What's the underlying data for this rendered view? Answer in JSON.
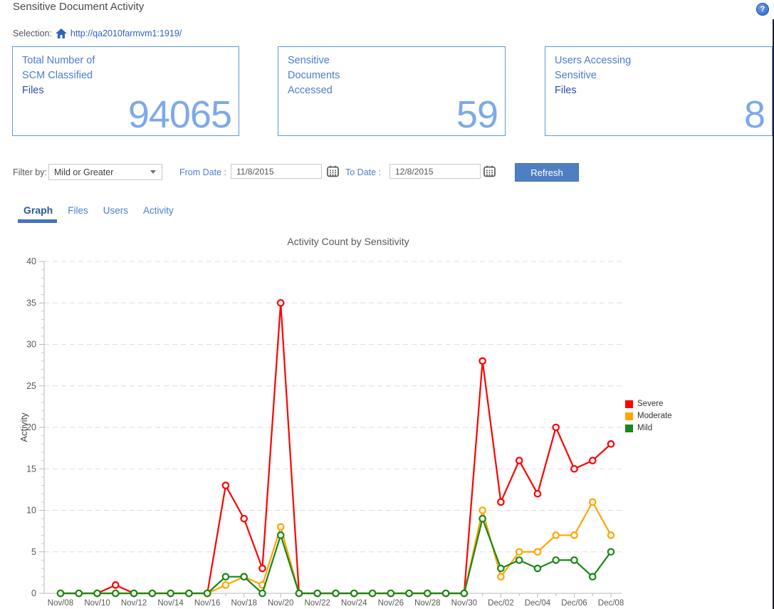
{
  "header": {
    "title": "Sensitive Document Activity",
    "help_glyph": "?"
  },
  "selection": {
    "label": "Selection:",
    "url": "http://qa2010farmvm1:1919/"
  },
  "cards": [
    {
      "lines": [
        "Total Number of",
        "SCM Classified",
        "Files"
      ],
      "dark_lines": [
        2
      ],
      "value": "94065"
    },
    {
      "lines": [
        "Sensitive",
        "Documents",
        "Accessed"
      ],
      "dark_lines": [],
      "value": "59"
    },
    {
      "lines": [
        "Users Accessing",
        "Sensitive",
        "Files"
      ],
      "dark_lines": [
        2
      ],
      "value": "8"
    }
  ],
  "filters": {
    "filter_by_label": "Filter by:",
    "filter_value": "Mild or Greater",
    "from_label": "From Date :",
    "from_value": "11/8/2015",
    "to_label": "To Date :",
    "to_value": "12/8/2015",
    "refresh_label": "Refresh"
  },
  "tabs": [
    {
      "label": "Graph",
      "active": true
    },
    {
      "label": "Files",
      "active": false
    },
    {
      "label": "Users",
      "active": false
    },
    {
      "label": "Activity",
      "active": false
    }
  ],
  "colors": {
    "accent_blue": "#4472c4",
    "card_border": "#5b9bd5",
    "link_blue": "#2e64bd",
    "refresh_button": "#4e80c1"
  },
  "chart_data": {
    "type": "line",
    "title": "Activity Count by Sensitivity",
    "xlabel": "",
    "ylabel": "Activity",
    "ylim": [
      0,
      40
    ],
    "ytick_step": 5,
    "x_labels_every": 2,
    "grid": "dashed-horizontal",
    "legend_position": "right",
    "marker": "open-circle",
    "categories": [
      "Nov/08",
      "Nov/09",
      "Nov/10",
      "Nov/11",
      "Nov/12",
      "Nov/13",
      "Nov/14",
      "Nov/15",
      "Nov/16",
      "Nov/17",
      "Nov/18",
      "Nov/19",
      "Nov/20",
      "Nov/21",
      "Nov/22",
      "Nov/23",
      "Nov/24",
      "Nov/25",
      "Nov/26",
      "Nov/27",
      "Nov/28",
      "Nov/29",
      "Nov/30",
      "Dec/01",
      "Dec/02",
      "Dec/03",
      "Dec/04",
      "Dec/05",
      "Dec/06",
      "Dec/07",
      "Dec/08"
    ],
    "series": [
      {
        "name": "Severe",
        "color": "#ff0000",
        "values": [
          0,
          0,
          0,
          1,
          0,
          0,
          0,
          0,
          0,
          13,
          9,
          3,
          35,
          0,
          0,
          0,
          0,
          0,
          0,
          0,
          0,
          0,
          0,
          28,
          11,
          16,
          12,
          20,
          15,
          16,
          18
        ]
      },
      {
        "name": "Moderate",
        "color": "#ffa500",
        "values": [
          0,
          0,
          0,
          0,
          0,
          0,
          0,
          0,
          0,
          1,
          2,
          1,
          8,
          0,
          0,
          0,
          0,
          0,
          0,
          0,
          0,
          0,
          0,
          10,
          2,
          5,
          5,
          7,
          7,
          11,
          7
        ]
      },
      {
        "name": "Mild",
        "color": "#178717",
        "values": [
          0,
          0,
          0,
          0,
          0,
          0,
          0,
          0,
          0,
          2,
          2,
          0,
          7,
          0,
          0,
          0,
          0,
          0,
          0,
          0,
          0,
          0,
          0,
          9,
          3,
          4,
          3,
          4,
          4,
          2,
          5
        ]
      }
    ]
  }
}
